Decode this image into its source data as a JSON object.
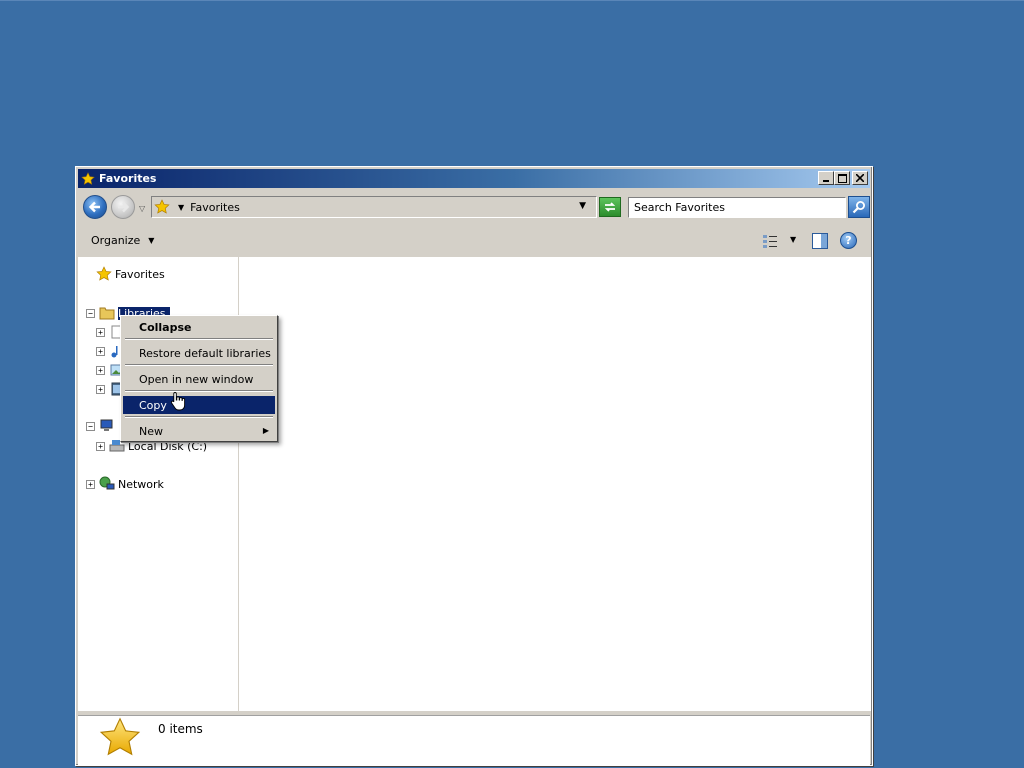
{
  "window": {
    "title": "Favorites",
    "buttons": {
      "minimize": "_",
      "maximize": "□",
      "close": "×"
    }
  },
  "address": {
    "location": "Favorites",
    "search_placeholder": "Search Favorites"
  },
  "toolbar": {
    "organize_label": "Organize"
  },
  "nav": {
    "favorites_label": "Favorites",
    "libraries_label": "Libraries",
    "local_disk_label": "Local Disk (C:)",
    "network_label": "Network",
    "expander_collapsed": "+",
    "expander_expanded": "−"
  },
  "context_menu": {
    "items": [
      {
        "label": "Collapse",
        "default": true
      },
      {
        "label": "Restore default libraries"
      },
      {
        "label": "Open in new window"
      },
      {
        "label": "Copy",
        "highlighted": true
      },
      {
        "label": "New",
        "submenu": true
      }
    ]
  },
  "details": {
    "items_count": "0 items"
  },
  "colors": {
    "desktop": "#3a6ea5",
    "selection": "#0a246a",
    "window_face": "#d4d0c8"
  },
  "icons": [
    "star-icon",
    "folder-icon",
    "computer-icon",
    "network-icon",
    "search-icon",
    "refresh-icon",
    "help-icon",
    "views-icon",
    "preview-pane-icon",
    "hand-cursor-icon"
  ]
}
